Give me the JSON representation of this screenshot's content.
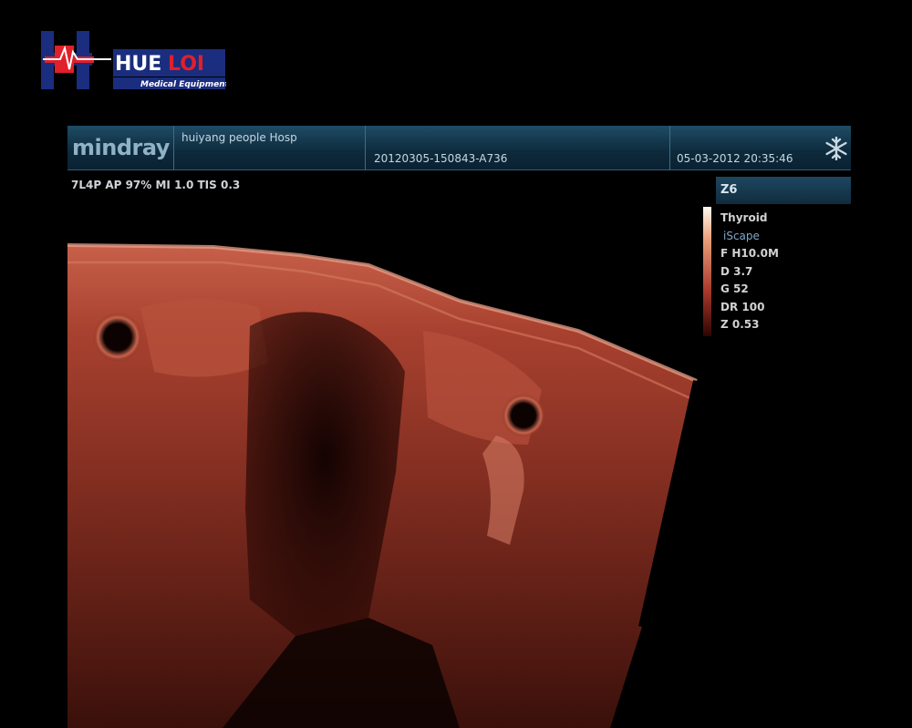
{
  "watermark": {
    "brand_left": "HUE",
    "brand_right": "LOI",
    "tagline": "Medical Equipment"
  },
  "header": {
    "brand": "mindray",
    "hospital": "huiyang people Hosp",
    "exam_id": "20120305-150843-A736",
    "datetime": "05-03-2012  20:35:46",
    "freeze_icon": "snowflake-icon"
  },
  "imaging_params": "7L4P  AP 97%  MI 1.0 TIS 0.3",
  "side_panel": {
    "tab": "Z6",
    "preset": "Thyroid",
    "mode": "iScape",
    "frequency": "F H10.0M",
    "depth": "D 3.7",
    "gain": "G 52",
    "dynamic_range": "DR 100",
    "zoom": "Z 0.53"
  },
  "colors": {
    "tint": "#b84433",
    "header": "#123a52",
    "logo_blue": "#1a2d7e",
    "logo_red": "#e0202a"
  }
}
